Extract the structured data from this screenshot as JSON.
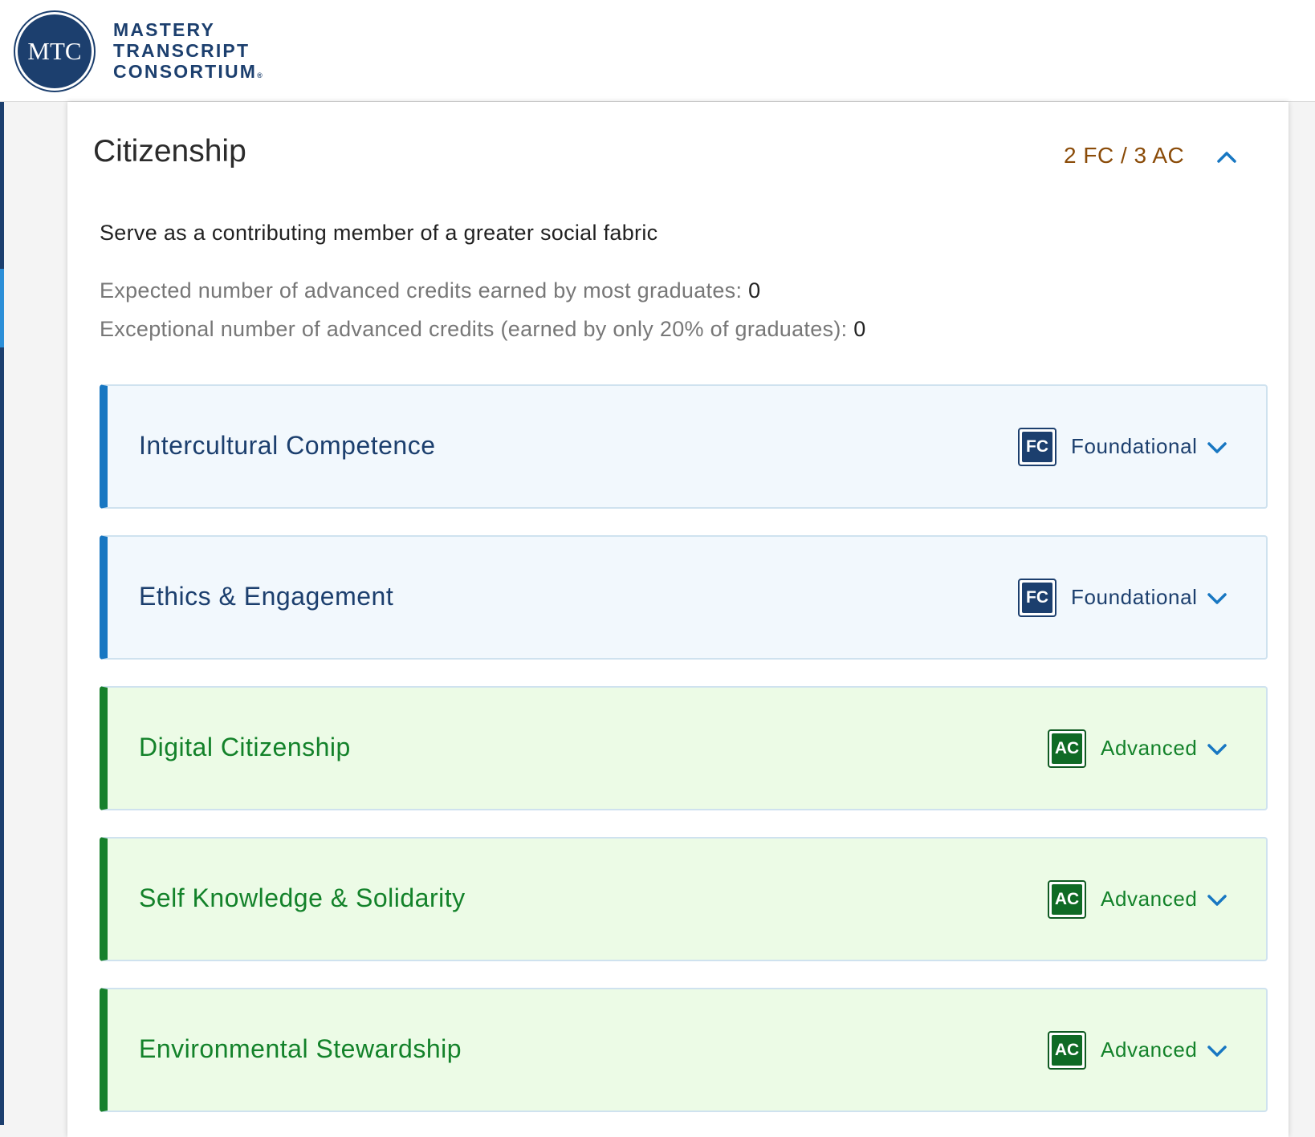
{
  "brand": {
    "logo_initials": "MTC",
    "name_lines": [
      "MASTERY",
      "TRANSCRIPT",
      "CONSORTIUM"
    ],
    "registered_mark": "®",
    "color": "#1c3f6e"
  },
  "section": {
    "title": "Citizenship",
    "credit_summary": "2 FC / 3 AC",
    "collapse_icon": "chevron-up-icon",
    "description": "Serve as a contributing member of a greater social fabric",
    "expected_label": "Expected number of advanced credits earned by most graduates:",
    "expected_value": "0",
    "exceptional_label": "Exceptional number of advanced credits (earned by only 20% of graduates):",
    "exceptional_value": "0"
  },
  "competencies": [
    {
      "title": "Intercultural Competence",
      "badge": "FC",
      "level": "Foundational",
      "type": "fc"
    },
    {
      "title": "Ethics & Engagement",
      "badge": "FC",
      "level": "Foundational",
      "type": "fc"
    },
    {
      "title": "Digital Citizenship",
      "badge": "AC",
      "level": "Advanced",
      "type": "ac"
    },
    {
      "title": "Self Knowledge & Solidarity",
      "badge": "AC",
      "level": "Advanced",
      "type": "ac"
    },
    {
      "title": "Environmental Stewardship",
      "badge": "AC",
      "level": "Advanced",
      "type": "ac"
    }
  ],
  "colors": {
    "foundational_accent": "#1877c2",
    "advanced_accent": "#16802b",
    "credit_summary": "#8a4b08"
  }
}
